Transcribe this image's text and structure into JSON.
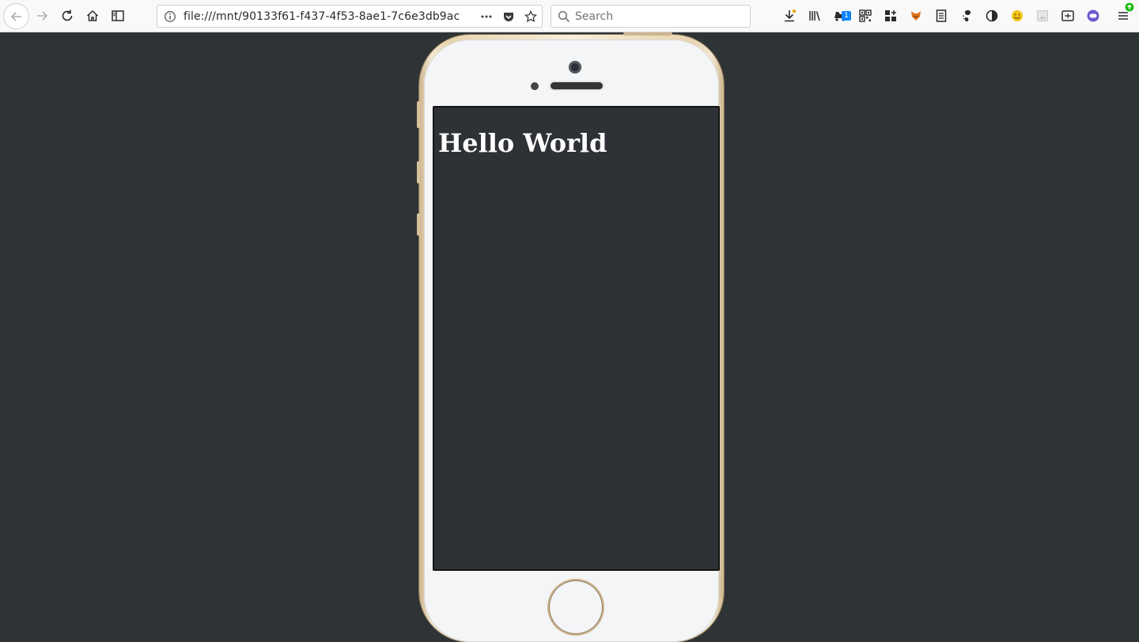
{
  "browser": {
    "url": "file:///mnt/90133f61-f437-4f53-8ae1-7c6e3db9ac",
    "search_placeholder": "Search",
    "notification_badge": "1",
    "icons": [
      "back-icon",
      "forward-icon",
      "reload-icon",
      "home-icon",
      "sidebar-icon",
      "info-icon",
      "page-actions-icon",
      "pocket-icon",
      "bookmark-star-icon",
      "search-icon",
      "downloads-icon",
      "library-icon",
      "notifications-icon",
      "qr-code-icon",
      "grid-icon",
      "fox-icon",
      "reader-icon",
      "gnome-icon",
      "circle-icon",
      "emoji-icon",
      "placeholder-icon",
      "screenshot-icon",
      "toggle-icon",
      "menu-icon"
    ]
  },
  "phone": {
    "screen_heading": "Hello World"
  },
  "colors": {
    "page_background": "#2e3336",
    "screen_background": "#2e3135",
    "phone_gold": "#e7d3ad",
    "phone_face": "#f4f5f7",
    "badge_blue": "#0a84ff",
    "update_green": "#12bc00"
  }
}
